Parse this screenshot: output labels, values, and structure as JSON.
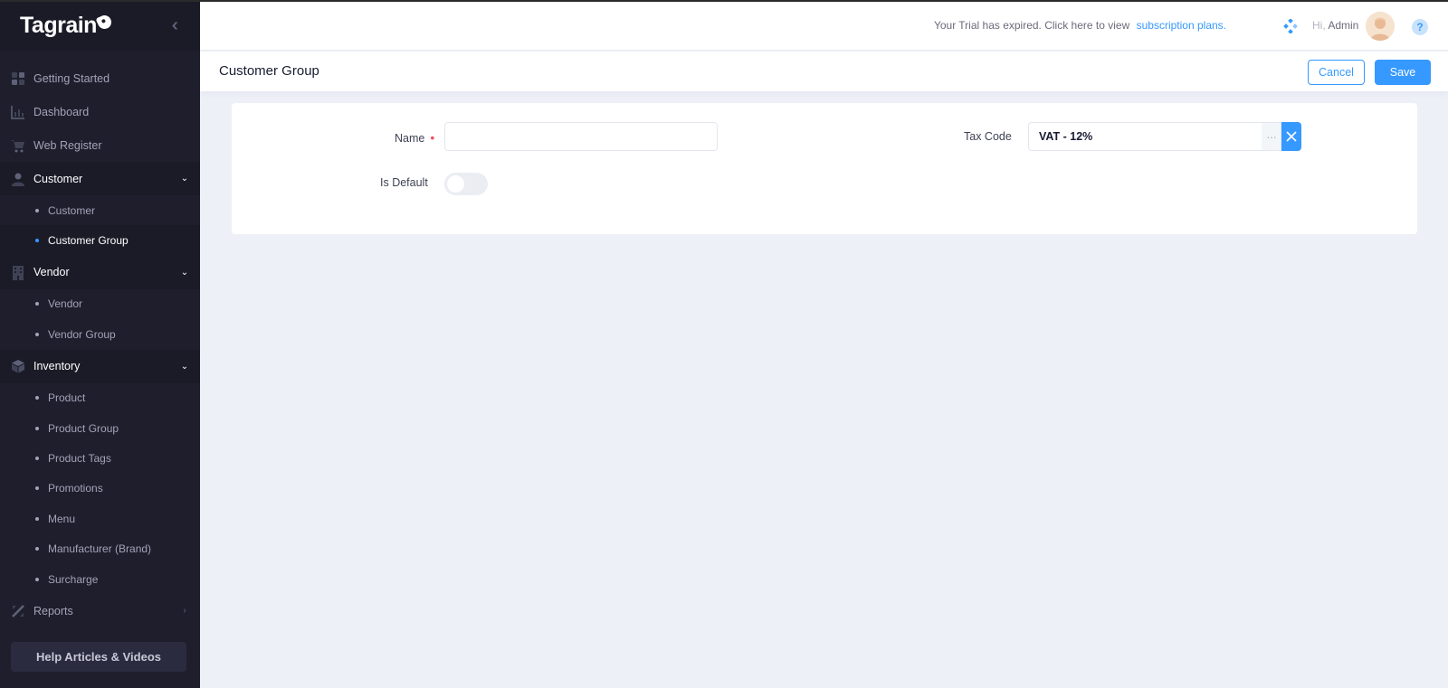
{
  "brand": {
    "name": "Tagrain"
  },
  "sidebar": {
    "items": [
      {
        "label": "Getting Started",
        "icon": "grid-icon"
      },
      {
        "label": "Dashboard",
        "icon": "chart-icon"
      },
      {
        "label": "Web Register",
        "icon": "cart-icon"
      },
      {
        "label": "Customer",
        "icon": "user-icon",
        "open": true,
        "children": [
          {
            "label": "Customer"
          },
          {
            "label": "Customer Group",
            "active": true
          }
        ]
      },
      {
        "label": "Vendor",
        "icon": "building-icon",
        "open": true,
        "children": [
          {
            "label": "Vendor"
          },
          {
            "label": "Vendor Group"
          }
        ]
      },
      {
        "label": "Inventory",
        "icon": "box-icon",
        "open": true,
        "children": [
          {
            "label": "Product"
          },
          {
            "label": "Product Group"
          },
          {
            "label": "Product Tags"
          },
          {
            "label": "Promotions"
          },
          {
            "label": "Menu"
          },
          {
            "label": "Manufacturer (Brand)"
          },
          {
            "label": "Surcharge"
          }
        ]
      },
      {
        "label": "Reports",
        "icon": "pencil-ruler-icon"
      }
    ],
    "help_label": "Help Articles & Videos"
  },
  "header": {
    "trial_text": "Your Trial has expired. Click here to view",
    "trial_link": "subscription plans.",
    "greeting": "Hi,",
    "user_name": "Admin"
  },
  "subheader": {
    "title": "Customer Group",
    "cancel_label": "Cancel",
    "save_label": "Save"
  },
  "form": {
    "name_label": "Name",
    "name_value": "",
    "is_default_label": "Is Default",
    "is_default_on": false,
    "tax_code_label": "Tax Code",
    "tax_code_value": "VAT - 12%"
  },
  "colors": {
    "accent": "#3699ff",
    "sidebar_bg": "#1e1e2d",
    "required": "#f64e60"
  }
}
